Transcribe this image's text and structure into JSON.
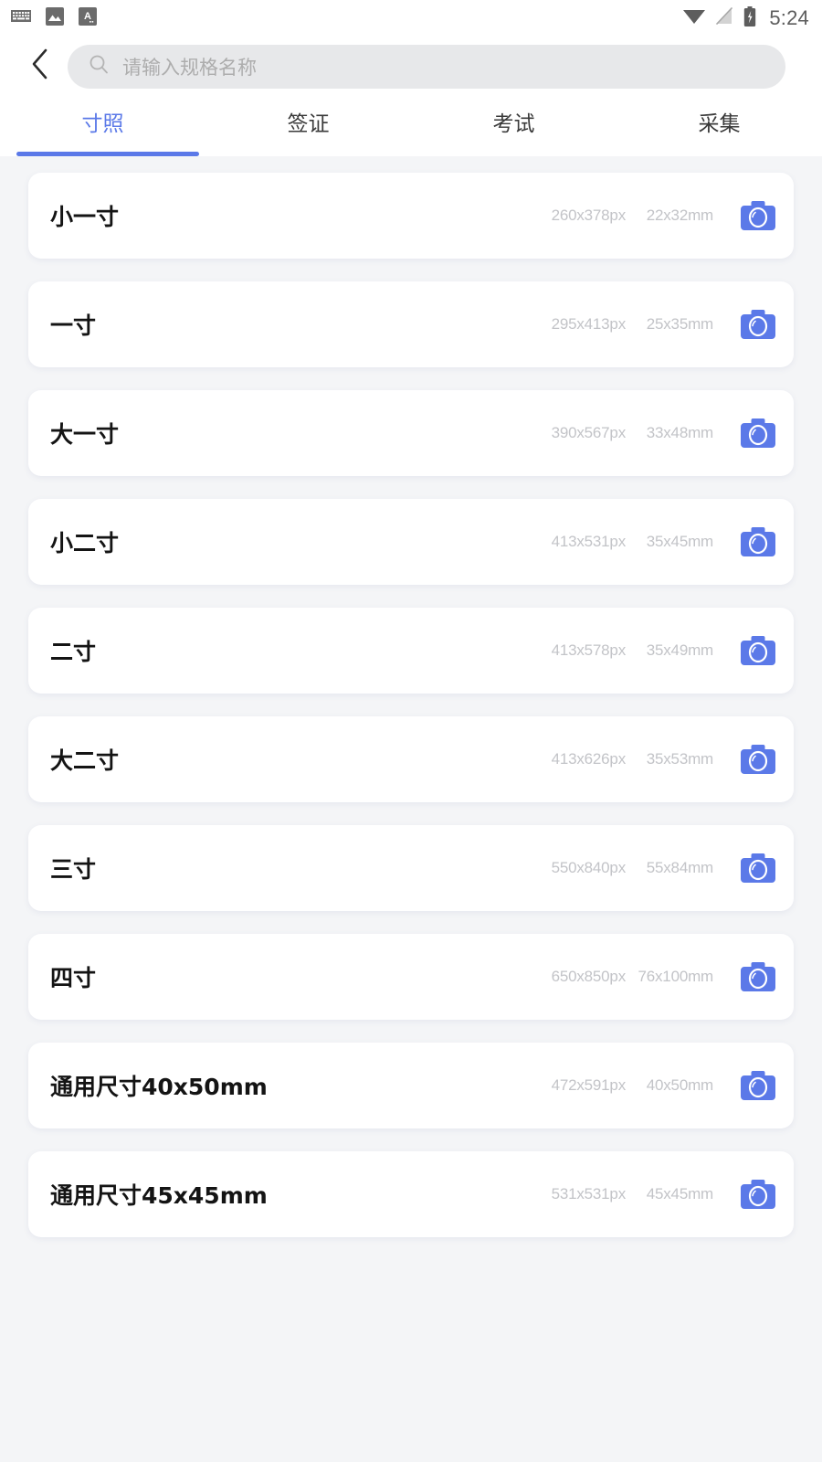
{
  "status_bar": {
    "left_icons": [
      "keyboard-icon",
      "image-icon",
      "translate-a-icon"
    ],
    "right_icons": [
      "wifi-icon",
      "no-signal-icon",
      "battery-charging-icon"
    ],
    "time": "5:24"
  },
  "header": {
    "back_icon": "chevron-left-icon",
    "search": {
      "icon": "search-icon",
      "value": "",
      "placeholder": "请输入规格名称"
    }
  },
  "tabs": {
    "active_index": 0,
    "accent_color": "#5b79e8",
    "items": [
      {
        "label": "寸照"
      },
      {
        "label": "签证"
      },
      {
        "label": "考试"
      },
      {
        "label": "采集"
      }
    ]
  },
  "list": {
    "action_icon": "camera-icon",
    "items": [
      {
        "name": "小一寸",
        "px": "260x378px",
        "mm": "22x32mm"
      },
      {
        "name": "一寸",
        "px": "295x413px",
        "mm": "25x35mm"
      },
      {
        "name": "大一寸",
        "px": "390x567px",
        "mm": "33x48mm"
      },
      {
        "name": "小二寸",
        "px": "413x531px",
        "mm": "35x45mm"
      },
      {
        "name": "二寸",
        "px": "413x578px",
        "mm": "35x49mm"
      },
      {
        "name": "大二寸",
        "px": "413x626px",
        "mm": "35x53mm"
      },
      {
        "name": "三寸",
        "px": "550x840px",
        "mm": "55x84mm"
      },
      {
        "name": "四寸",
        "px": "650x850px",
        "mm": "76x100mm"
      },
      {
        "name": "通用尺寸40x50mm",
        "px": "472x591px",
        "mm": "40x50mm"
      },
      {
        "name": "通用尺寸45x45mm",
        "px": "531x531px",
        "mm": "45x45mm"
      }
    ]
  }
}
